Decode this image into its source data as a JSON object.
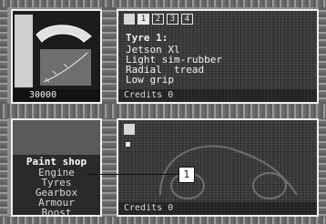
{
  "top_left": {
    "price": "30000"
  },
  "top_right": {
    "tabs": [
      "1",
      "2",
      "3",
      "4"
    ],
    "active_tab": "1",
    "title": "Tyre 1:",
    "lines": [
      "Jetson Xl",
      "Light sim-rubber",
      "Radial  tread",
      "Low grip"
    ],
    "credits_label": "Credits",
    "credits_value": "0"
  },
  "bottom_left": {
    "menu_title": "Paint shop",
    "menu_items": [
      "Engine",
      "Tyres",
      "Gearbox",
      "Armour",
      "Boost"
    ]
  },
  "bottom_right": {
    "credits_label": "Credits",
    "credits_value": "0"
  },
  "callout": {
    "number": "1"
  }
}
